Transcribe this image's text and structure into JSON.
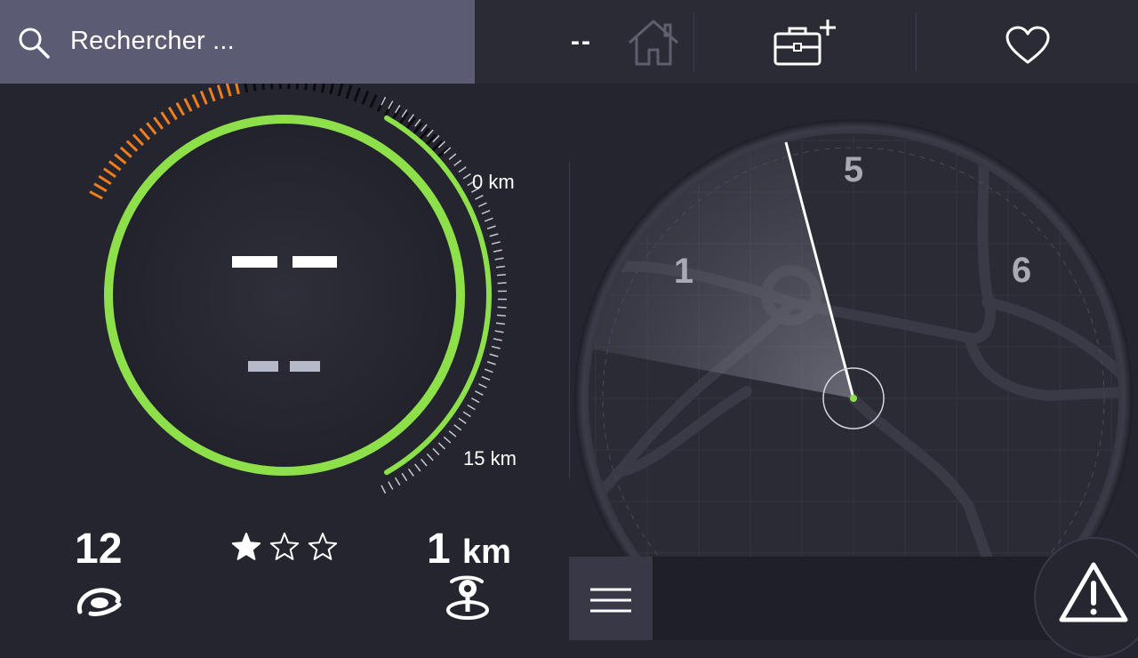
{
  "search": {
    "placeholder": "Rechercher ..."
  },
  "header": {
    "home_value": "--"
  },
  "gauge": {
    "km_top": "0 km",
    "km_bottom": "15 km",
    "ring_color": "#8ee04a",
    "warning_color": "#f07e1c"
  },
  "stats": {
    "customers": "12",
    "rating": {
      "filled": 1,
      "total": 3
    },
    "distance_value": "1",
    "distance_unit": "km"
  },
  "radar": {
    "zones": [
      "1",
      "5",
      "6"
    ]
  },
  "icons": {
    "search": "search-icon",
    "home": "home-icon",
    "briefcase": "briefcase-plus-icon",
    "heart": "heart-icon",
    "menu": "menu-icon",
    "alert": "warning-triangle-icon"
  }
}
